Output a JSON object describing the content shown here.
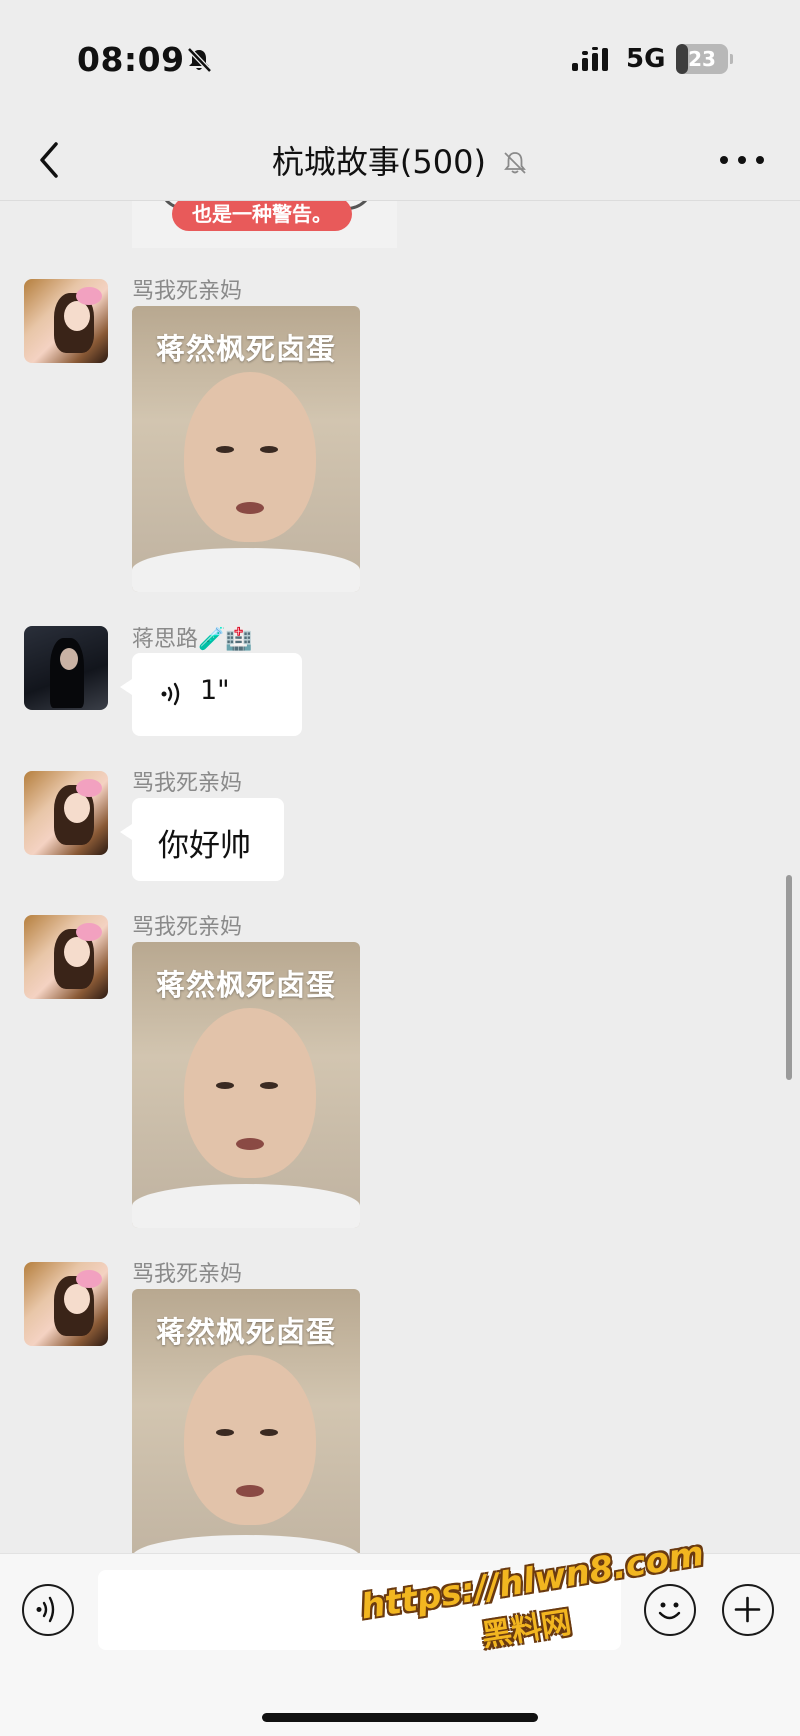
{
  "status_bar": {
    "time": "08:09",
    "network": "5G",
    "battery": "23",
    "battery_fraction": 0.23
  },
  "header": {
    "title": "杭城故事(500)"
  },
  "previous_image": {
    "caption": "也是一种警告。"
  },
  "messages": [
    {
      "sender": "骂我死亲妈",
      "type": "image",
      "caption": "蒋然枫死卤蛋"
    },
    {
      "sender": "蒋思路🧪🏥",
      "type": "voice",
      "duration": "1\""
    },
    {
      "sender": "骂我死亲妈",
      "type": "text",
      "text": "你好帅"
    },
    {
      "sender": "骂我死亲妈",
      "type": "image",
      "caption": "蒋然枫死卤蛋"
    },
    {
      "sender": "骂我死亲妈",
      "type": "image",
      "caption": "蒋然枫死卤蛋"
    }
  ],
  "input_bar": {
    "placeholder": ""
  },
  "watermark": {
    "url": "https://hlwn8.com",
    "name": "黑料网"
  },
  "colors": {
    "background": "#ededed",
    "bubble": "#ffffff",
    "watermark": "#f2b620"
  },
  "icons": [
    "mute-icon",
    "signal-icon",
    "back-icon",
    "bell-muted-icon",
    "more-icon",
    "voice-icon",
    "emoji-icon",
    "plus-icon"
  ]
}
